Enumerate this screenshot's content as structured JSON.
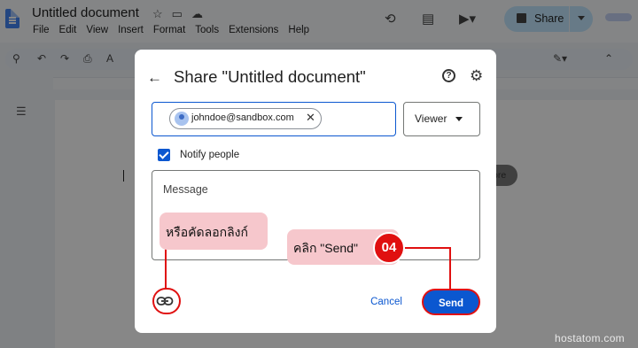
{
  "app": {
    "doc_title": "Untitled document",
    "menu": [
      "File",
      "Edit",
      "View",
      "Insert",
      "Format",
      "Tools",
      "Extensions",
      "Help"
    ],
    "share_label": "Share",
    "bg_button_partial": "ore"
  },
  "dialog": {
    "title": "Share \"Untitled document\"",
    "recipient_email": "johndoe@sandbox.com",
    "role": "Viewer",
    "notify_label": "Notify people",
    "message_placeholder": "Message",
    "cancel_label": "Cancel",
    "send_label": "Send"
  },
  "annotations": {
    "copy_link_note": "หรือคัดลอกลิงก์",
    "send_note": "คลิก \"Send\"",
    "step_number": "04",
    "accent_color": "#e01010",
    "bubble_color": "#f6c7cc"
  },
  "watermark": "hostatom.com",
  "icons": {
    "header": [
      "docs-logo-icon",
      "star-icon",
      "move-folder-icon",
      "cloud-status-icon",
      "history-icon",
      "comment-icon",
      "meet-icon",
      "lock-icon"
    ],
    "toolbar": [
      "search-icon",
      "undo-icon",
      "redo-icon",
      "print-icon",
      "spellcheck-icon",
      "paint-format-icon",
      "edit-mode-icon",
      "collapse-icon"
    ],
    "dialog": [
      "back-arrow-icon",
      "help-icon",
      "gear-icon",
      "close-icon",
      "link-icon",
      "dropdown-arrow-icon",
      "checkbox-checked-icon"
    ]
  }
}
